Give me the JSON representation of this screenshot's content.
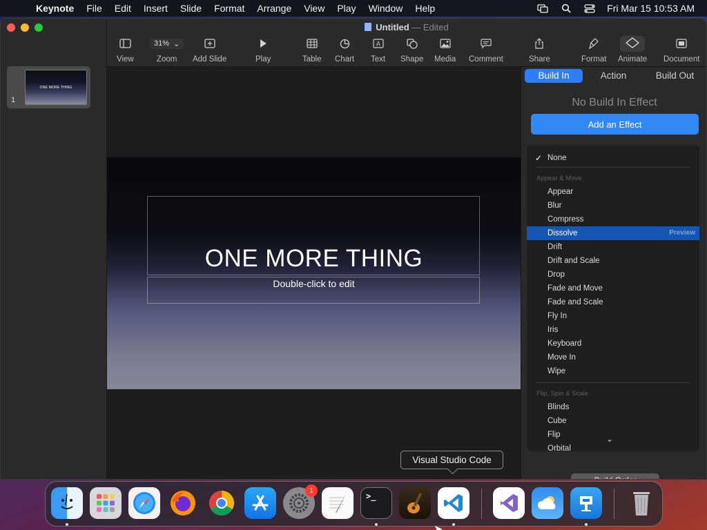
{
  "menubar": {
    "app": "Keynote",
    "items": [
      "File",
      "Edit",
      "Insert",
      "Slide",
      "Format",
      "Arrange",
      "View",
      "Play",
      "Window",
      "Help"
    ],
    "clock": "Fri Mar 15  10:53 AM"
  },
  "window": {
    "doc_title": "Untitled",
    "doc_status": "— Edited"
  },
  "toolbar": {
    "view": "View",
    "zoom_value": "31%",
    "zoom": "Zoom",
    "add_slide": "Add Slide",
    "play": "Play",
    "table": "Table",
    "chart": "Chart",
    "text": "Text",
    "shape": "Shape",
    "media": "Media",
    "comment": "Comment",
    "share": "Share",
    "format": "Format",
    "animate": "Animate",
    "document": "Document"
  },
  "navigator": {
    "slide_number": "1",
    "thumb_text": "ONE MORE THING"
  },
  "slide": {
    "title": "ONE MORE THING",
    "subtitle": "Double-click to edit"
  },
  "inspector": {
    "tabs": [
      "Build In",
      "Action",
      "Build Out"
    ],
    "no_effect": "No Build In Effect",
    "add_effect": "Add an Effect",
    "none_label": "None",
    "group_appear": "Appear & Move",
    "group_flip": "Flip, Spin & Scale",
    "effects_appear": [
      "Appear",
      "Blur",
      "Compress",
      "Dissolve",
      "Drift",
      "Drift and Scale",
      "Drop",
      "Fade and Move",
      "Fade and Scale",
      "Fly In",
      "Iris",
      "Keyboard",
      "Move In",
      "Wipe"
    ],
    "effects_flip": [
      "Blinds",
      "Cube",
      "Flip",
      "Orbital"
    ],
    "selected": "Dissolve",
    "preview": "Preview",
    "build_order": "Build Order"
  },
  "tooltip": "Visual Studio Code",
  "dock": {
    "badge_count": "1"
  },
  "colors": {
    "accent": "#2f7df6",
    "selection": "#1657b6"
  }
}
